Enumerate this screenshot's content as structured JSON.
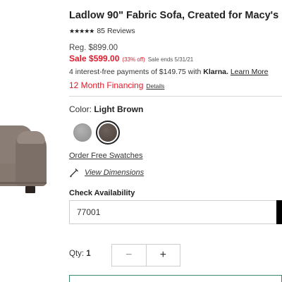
{
  "product": {
    "title": "Ladlow 90\" Fabric Sofa, Created for Macy's",
    "stars": "★★★★★",
    "reviews": "85 Reviews"
  },
  "pricing": {
    "regular": "Reg. $899.00",
    "sale": "Sale $599.00",
    "discount": "(33% off)",
    "sale_ends": "Sale ends 5/31/21",
    "klarna_prefix": "4 interest-free payments of $149.75 with ",
    "klarna_brand": "Klarna.",
    "klarna_learn": "Learn More",
    "financing": "12 Month Financing",
    "financing_details": "Details"
  },
  "color": {
    "label": "Color: ",
    "selected": "Light Brown",
    "swatches": [
      {
        "name": "grey",
        "color": "#9e9e9e"
      },
      {
        "name": "light-brown",
        "color": "#5a4e48"
      }
    ]
  },
  "links": {
    "swatches": "Order Free Swatches",
    "dimensions": "View Dimensions"
  },
  "availability": {
    "label": "Check Availability",
    "zip": "77001"
  },
  "quantity": {
    "label": "Qty: ",
    "value": "1",
    "minus": "−",
    "plus": "+"
  },
  "icons": {
    "dimensions": "pencil-ruler-icon"
  }
}
